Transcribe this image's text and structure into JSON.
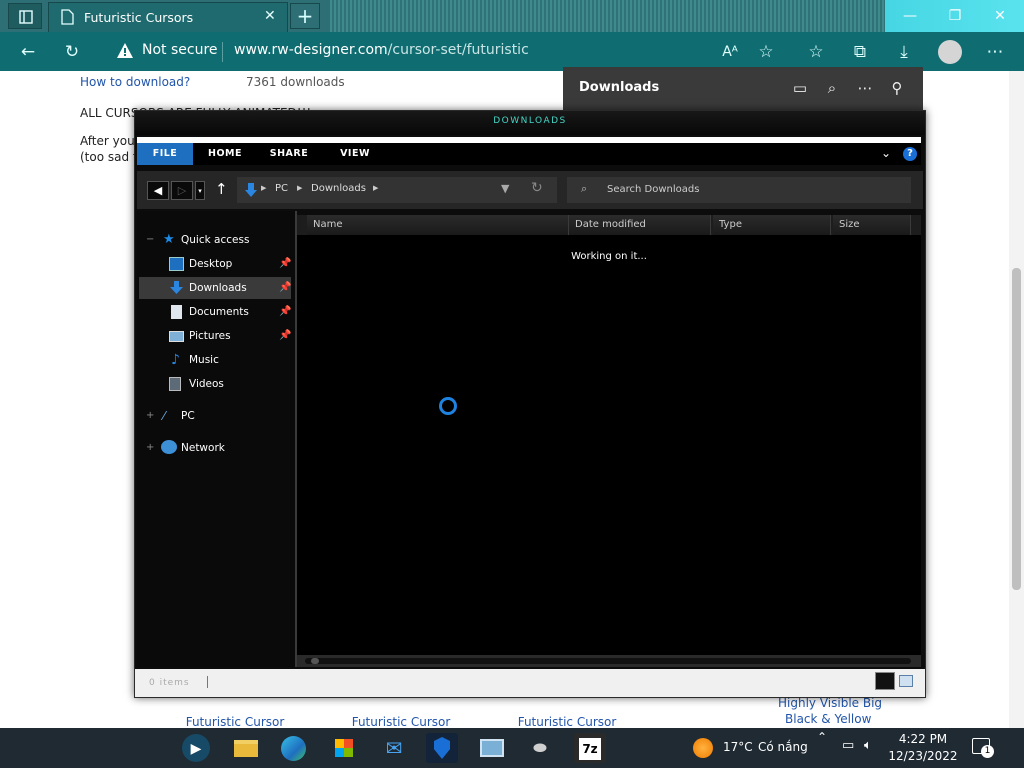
{
  "browser": {
    "tab_title": "Futuristic Cursors",
    "security": "Not secure",
    "url_host": "www.rw-designer.com",
    "url_path": "/cursor-set/futuristic"
  },
  "page": {
    "how_to_download": "How to download?",
    "downloads_count": "7361 downloads",
    "notice": "ALL CURSORS ARE FULLY ANIMATED!!!",
    "after_text": "After you",
    "after_text2": "(too sad t",
    "cards": [
      "Futuristic Cursor",
      "Futuristic Cursor",
      "Futuristic Cursor"
    ],
    "highly_visible": "Highly Visible Big",
    "black_yellow": "Black & Yellow"
  },
  "downloads_panel": {
    "title": "Downloads"
  },
  "explorer": {
    "window_title": "DOWNLOADS",
    "ribbon_tabs": [
      "FILE",
      "HOME",
      "SHARE",
      "VIEW"
    ],
    "help": "?",
    "breadcrumb": [
      "PC",
      "Downloads"
    ],
    "search_placeholder": "Search Downloads",
    "sidebar": {
      "quick_access": "Quick access",
      "items": [
        "Desktop",
        "Downloads",
        "Documents",
        "Pictures",
        "Music",
        "Videos"
      ],
      "pc": "PC",
      "network": "Network"
    },
    "columns": [
      "Name",
      "Date modified",
      "Type",
      "Size"
    ],
    "status": "Working on it...",
    "statusbar_text": "0 items"
  },
  "taskbar": {
    "temp": "17°C",
    "weather": "Có nắng",
    "time": "4:22 PM",
    "date": "12/23/2022",
    "notif_count": "1",
    "app_7z": "7z"
  },
  "colors": {
    "accent": "#1e6fbf",
    "edge_bar": "#0f6d71",
    "title_glow": "#45d6c6"
  }
}
